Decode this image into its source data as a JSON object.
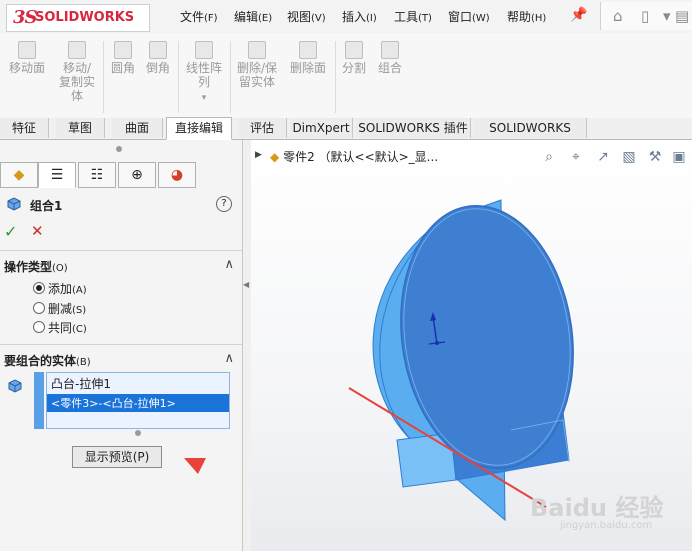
{
  "app": {
    "logo_ds": "3S",
    "logo_text": "SOLIDWORKS"
  },
  "menu": [
    {
      "label": "文件",
      "key": "(F)"
    },
    {
      "label": "编辑",
      "key": "(E)"
    },
    {
      "label": "视图",
      "key": "(V)"
    },
    {
      "label": "插入",
      "key": "(I)"
    },
    {
      "label": "工具",
      "key": "(T)"
    },
    {
      "label": "窗口",
      "key": "(W)"
    },
    {
      "label": "帮助",
      "key": "(H)"
    }
  ],
  "ribbon": [
    {
      "line1": "移动面",
      "line2": "",
      "line3": ""
    },
    {
      "line1": "移动/",
      "line2": "复制实",
      "line3": "体"
    },
    {
      "line1": "圆角",
      "line2": "",
      "line3": ""
    },
    {
      "line1": "倒角",
      "line2": "",
      "line3": ""
    },
    {
      "line1": "线性阵",
      "line2": "列",
      "line3": ""
    },
    {
      "line1": "删除/保",
      "line2": "留实体",
      "line3": ""
    },
    {
      "line1": "删除面",
      "line2": "",
      "line3": ""
    },
    {
      "line1": "分割",
      "line2": "",
      "line3": ""
    },
    {
      "line1": "组合",
      "line2": "",
      "line3": ""
    }
  ],
  "tabs": [
    "特征",
    "草图",
    "曲面",
    "直接编辑",
    "评估",
    "DimXpert",
    "SOLIDWORKS 插件",
    "SOLIDWORKS MBD"
  ],
  "panel": {
    "feature_title": "组合1",
    "help": "?",
    "ok": "✓",
    "cancel": "✕",
    "op_type": {
      "title": "操作类型",
      "key": "(O)"
    },
    "options": [
      {
        "label": "添加",
        "key": "(A)",
        "selected": true
      },
      {
        "label": "删减",
        "key": "(S)",
        "selected": false
      },
      {
        "label": "共同",
        "key": "(C)",
        "selected": false
      }
    ],
    "bodies": {
      "title": "要组合的实体",
      "key": "(B)"
    },
    "body_list": [
      "凸台-拉伸1",
      "<零件3>-<凸台-拉伸1>"
    ],
    "preview_button": "显示预览(P)"
  },
  "viewport": {
    "breadcrumb": "零件2 （默认<<默认>_显...",
    "watermark": "Baidu 经验",
    "watermark_url": "jingyan.baidu.com"
  },
  "colors": {
    "accent": "#3a7bd5",
    "selection": "#1a73d9",
    "part": "#4f8fe0",
    "arrow": "#e8433a"
  }
}
